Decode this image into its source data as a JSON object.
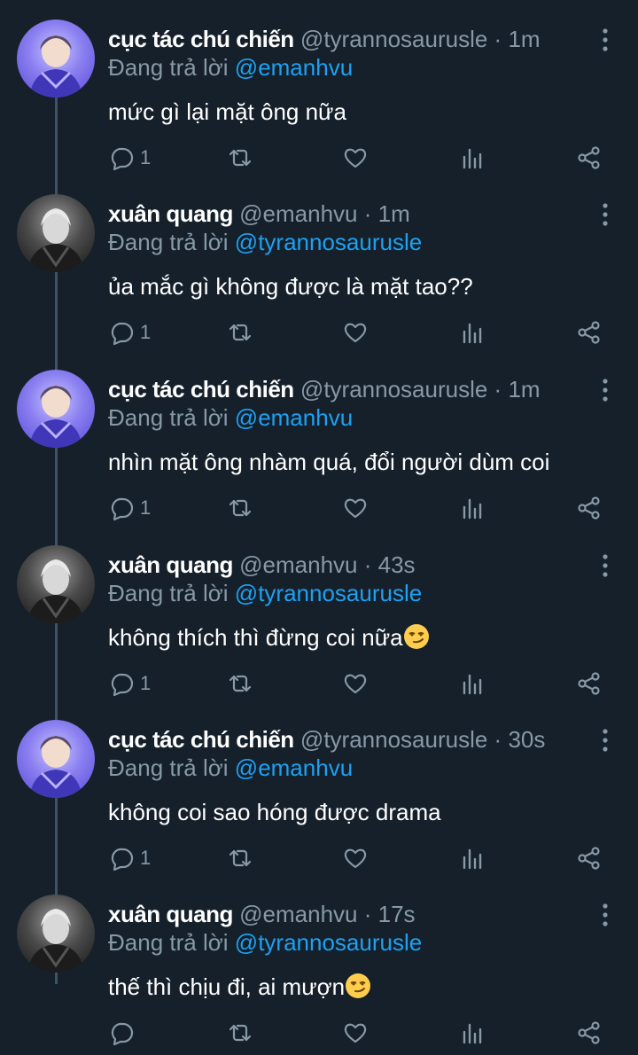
{
  "colors": {
    "background": "#15202b",
    "primary_text": "#ffffff",
    "secondary_text": "#8899a6",
    "link": "#1da1f2",
    "thread_line": "#3d5466"
  },
  "labels": {
    "replying_to": "Đang trả lời",
    "dot": "·"
  },
  "icons": [
    "reply-icon",
    "retweet-icon",
    "like-icon",
    "analytics-icon",
    "share-icon",
    "more-icon",
    "smirk-emoji-icon"
  ],
  "tweets": [
    {
      "name": "cục tác chú chiến",
      "handle": "@tyrannosaurusle",
      "time": "1m",
      "reply_to": "@emanhvu",
      "text": "mức gì lại mặt ông nữa",
      "replies": "1"
    },
    {
      "name": "xuân quang",
      "handle": "@emanhvu",
      "time": "1m",
      "reply_to": "@tyrannosaurusle",
      "text": "ủa mắc gì không được là mặt tao??",
      "replies": "1"
    },
    {
      "name": "cục tác chú chiến",
      "handle": "@tyrannosaurusle",
      "time": "1m",
      "reply_to": "@emanhvu",
      "text": "nhìn mặt ông nhàm quá, đổi người dùm coi",
      "replies": "1"
    },
    {
      "name": "xuân quang",
      "handle": "@emanhvu",
      "time": "43s",
      "reply_to": "@tyrannosaurusle",
      "text": "không thích thì đừng coi nữa",
      "replies": "1"
    },
    {
      "name": "cục tác chú chiến",
      "handle": "@tyrannosaurusle",
      "time": "30s",
      "reply_to": "@emanhvu",
      "text": "không coi sao hóng được drama",
      "replies": "1"
    },
    {
      "name": "xuân quang",
      "handle": "@emanhvu",
      "time": "17s",
      "reply_to": "@tyrannosaurusle",
      "text": "thế thì chịu đi, ai mượn",
      "replies": ""
    }
  ]
}
